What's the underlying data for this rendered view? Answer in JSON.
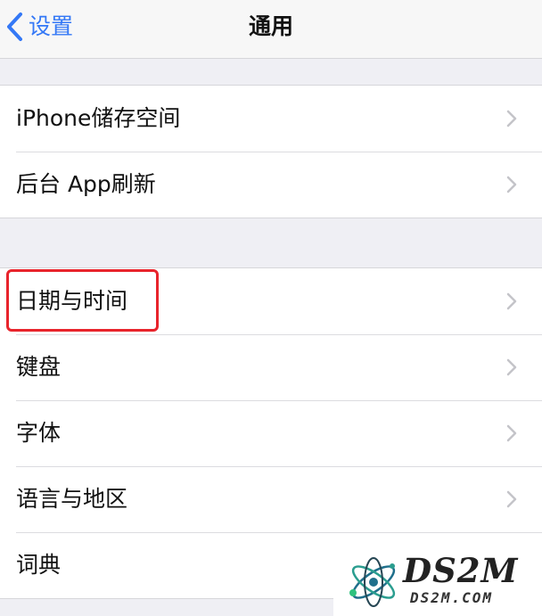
{
  "navbar": {
    "back_label": "设置",
    "title": "通用"
  },
  "groups": [
    {
      "items": [
        {
          "label": "iPhone储存空间"
        },
        {
          "label": "后台 App刷新"
        }
      ]
    },
    {
      "items": [
        {
          "label": "日期与时间",
          "highlighted": true
        },
        {
          "label": "键盘"
        },
        {
          "label": "字体"
        },
        {
          "label": "语言与地区"
        },
        {
          "label": "词典"
        }
      ]
    }
  ],
  "colors": {
    "accent": "#3478f6",
    "highlight": "#e8242c",
    "background": "#efeff4"
  },
  "watermark": {
    "main": "DS2M",
    "sub": "DS2M.COM"
  }
}
